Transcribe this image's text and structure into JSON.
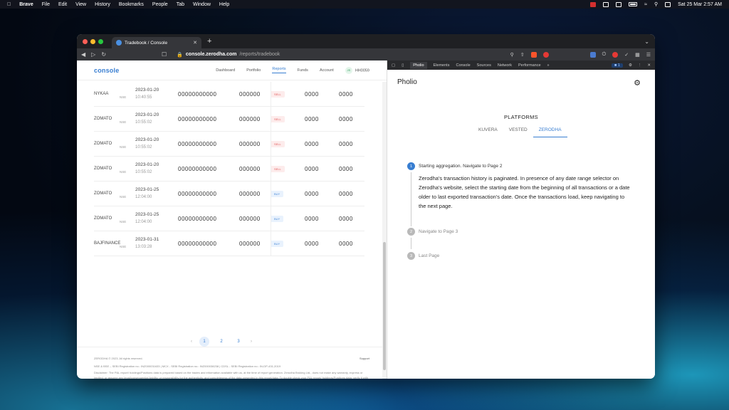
{
  "menubar": {
    "app": "Brave",
    "items": [
      "File",
      "Edit",
      "View",
      "History",
      "Bookmarks",
      "People",
      "Tab",
      "Window",
      "Help"
    ],
    "clock": "Sat 25 Mar  2:57 AM"
  },
  "browser": {
    "tab_title": "Tradebook / Console",
    "url_host": "console.zerodha.com",
    "url_path": "/reports/tradebook",
    "brave_badge": "1"
  },
  "site": {
    "logo": "console",
    "nav": [
      "Dashboard",
      "Portfolio",
      "Reports",
      "Funds",
      "Account"
    ],
    "user_initials": "JS",
    "user_id": "HH0059",
    "rows": [
      {
        "symbol": "NYKAA",
        "exchange": "NSE",
        "date": "2023-01-20",
        "time": "10:40:55",
        "order_id": "00000000000",
        "trade_id": "000000",
        "type": "SELL",
        "qty": "0000",
        "price": "0000"
      },
      {
        "symbol": "ZOMATO",
        "exchange": "NSE",
        "date": "2023-01-20",
        "time": "10:55:02",
        "order_id": "00000000000",
        "trade_id": "000000",
        "type": "SELL",
        "qty": "0000",
        "price": "0000"
      },
      {
        "symbol": "ZOMATO",
        "exchange": "NSE",
        "date": "2023-01-20",
        "time": "10:55:02",
        "order_id": "00000000000",
        "trade_id": "000000",
        "type": "SELL",
        "qty": "0000",
        "price": "0000"
      },
      {
        "symbol": "ZOMATO",
        "exchange": "NSE",
        "date": "2023-01-20",
        "time": "10:55:02",
        "order_id": "00000000000",
        "trade_id": "000000",
        "type": "SELL",
        "qty": "0000",
        "price": "0000"
      },
      {
        "symbol": "ZOMATO",
        "exchange": "NSE",
        "date": "2023-01-25",
        "time": "12:04:00",
        "order_id": "00000000000",
        "trade_id": "000000",
        "type": "BUY",
        "qty": "0000",
        "price": "0000"
      },
      {
        "symbol": "ZOMATO",
        "exchange": "NSE",
        "date": "2023-01-25",
        "time": "12:04:00",
        "order_id": "00000000000",
        "trade_id": "000000",
        "type": "BUY",
        "qty": "0000",
        "price": "0000"
      },
      {
        "symbol": "BAJFINANCE",
        "exchange": "NSE",
        "date": "2023-01-31",
        "time": "13:03:28",
        "order_id": "00000000000",
        "trade_id": "000000",
        "type": "BUY",
        "qty": "0000",
        "price": "0000"
      }
    ],
    "pagination": {
      "prev": "‹",
      "pages": [
        "1",
        "2",
        "3"
      ],
      "next": "›",
      "current": "1"
    },
    "footer": {
      "brand": "ZERODHA",
      "copyright": "© 2023. All rights reserved.",
      "support": "Support",
      "registration": "NSE & BSE – SEBI Registration no.: INZ000031633 | MCX - SEBI Registration no.: INZ000038238 | CDSL - SEBI Registration no.: IN-DP-431-2019",
      "disclaimer": "Disclaimer: The P&L report/ holdings/Positions data is prepared based on the trades and information available with us, at the time of report generation. Zerodha Broking Ltd., does not make any warranty, express or implied, or assume any legal/consequential liability, or responsibility for the authenticity, and completeness of the data presented in this report/data. To double check your P&L report/ holdings/Positions data, verify it with the Tradebook, Contract Notes and the Funds Statement which are available with you at all times."
    }
  },
  "devtools": {
    "tabs": [
      "Pholio",
      "Elements",
      "Console",
      "Sources",
      "Network",
      "Performance"
    ],
    "issues_count": "1"
  },
  "panel": {
    "title": "Pholio",
    "platforms_heading": "PLATFORMS",
    "platform_tabs": [
      "KUVERA",
      "VESTED",
      "ZERODHA"
    ],
    "steps": [
      {
        "num": "1",
        "title": "Starting aggregation. Navigate to Page 2",
        "body": "Zerodha's transaction history is paginated. In presence of any date range selector on Zerodha's website, select the starting date from the beginning of all transactions or a date older to last exported transaction's date. Once the transactions load, keep navigating to the next page."
      },
      {
        "num": "2",
        "title": "Navigate to Page 3"
      },
      {
        "num": "3",
        "title": "Last Page"
      }
    ]
  }
}
